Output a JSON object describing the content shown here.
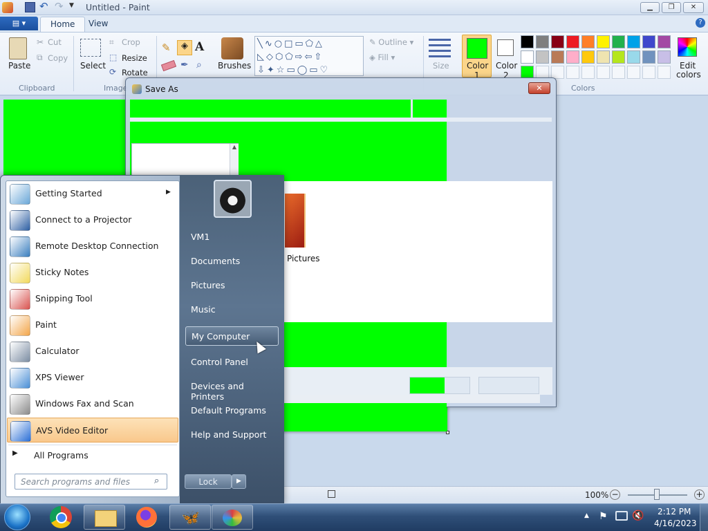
{
  "window": {
    "title": "Untitled - Paint"
  },
  "ribbon": {
    "tabs": [
      "Home",
      "View"
    ],
    "clipboard": {
      "paste": "Paste",
      "cut": "Cut",
      "copy": "Copy",
      "group": "Clipboard"
    },
    "image": {
      "select": "Select",
      "crop": "Crop",
      "resize": "Resize",
      "rotate": "Rotate",
      "group": "Image"
    },
    "brushes": "Brushes",
    "shapes": {
      "outline": "Outline",
      "fill": "Fill"
    },
    "size": "Size",
    "color1": {
      "label": "Color",
      "num": "1"
    },
    "color2": {
      "label": "Color",
      "num": "2"
    },
    "colors_group": "Colors",
    "edit_colors": {
      "line1": "Edit",
      "line2": "colors"
    },
    "palette_row1": [
      "#000000",
      "#7f7f7f",
      "#880015",
      "#ed1c24",
      "#ff7f27",
      "#fff200",
      "#22b14c",
      "#00a2e8",
      "#3f48cc",
      "#a349a4"
    ],
    "palette_row2": [
      "#ffffff",
      "#c3c3c3",
      "#b97a57",
      "#ffaec9",
      "#ffc90e",
      "#efe4b0",
      "#b5e61d",
      "#99d9ea",
      "#7092be",
      "#c8bfe7"
    ],
    "palette_row3": [
      "#00ff00",
      "",
      "",
      "",
      "",
      "",
      "",
      "",
      "",
      ""
    ],
    "primary_color": "#00ff00",
    "secondary_color": "#ffffff"
  },
  "dialog": {
    "title": "Save As",
    "folder_label": "Pictures"
  },
  "start_menu": {
    "programs": [
      {
        "label": "Getting Started",
        "icon": "getting-started-icon",
        "arrow": true
      },
      {
        "label": "Connect to a Projector",
        "icon": "projector-icon"
      },
      {
        "label": "Remote Desktop Connection",
        "icon": "remote-desktop-icon"
      },
      {
        "label": "Sticky Notes",
        "icon": "sticky-notes-icon"
      },
      {
        "label": "Snipping Tool",
        "icon": "snipping-tool-icon"
      },
      {
        "label": "Paint",
        "icon": "paint-icon"
      },
      {
        "label": "Calculator",
        "icon": "calculator-icon"
      },
      {
        "label": "XPS Viewer",
        "icon": "xps-viewer-icon"
      },
      {
        "label": "Windows Fax and Scan",
        "icon": "fax-icon"
      },
      {
        "label": "AVS Video Editor",
        "icon": "avs-butterfly-icon"
      }
    ],
    "all_programs": "All Programs",
    "search_placeholder": "Search programs and files",
    "right_items": [
      "VM1",
      "Documents",
      "Pictures",
      "Music",
      "My Computer",
      "Control Panel",
      "Devices and Printers",
      "Default Programs",
      "Help and Support"
    ],
    "lock": "Lock"
  },
  "status": {
    "zoom": "100%"
  },
  "taskbar": {
    "time": "2:12 PM",
    "date": "4/16/2023"
  }
}
